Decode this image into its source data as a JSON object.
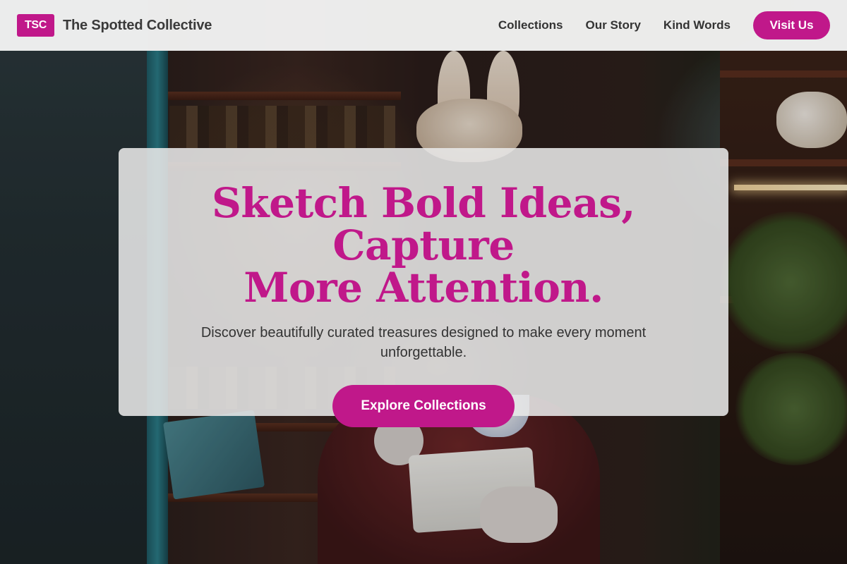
{
  "header": {
    "logo_text": "TSC",
    "brand_name": "The Spotted Collective",
    "nav": [
      {
        "label": "Collections"
      },
      {
        "label": "Our Story"
      },
      {
        "label": "Kind Words"
      }
    ],
    "cta_label": "Visit Us"
  },
  "hero": {
    "title_line1": "Sketch Bold Ideas, Capture",
    "title_line2": "More Attention.",
    "subtitle": "Discover beautifully curated treasures designed to make every moment unforgettable.",
    "button_label": "Explore Collections"
  },
  "colors": {
    "accent": "#c0188a",
    "header_bg": "#f4f4f4",
    "card_bg": "#e8e8e8",
    "text_dark": "#333333"
  }
}
